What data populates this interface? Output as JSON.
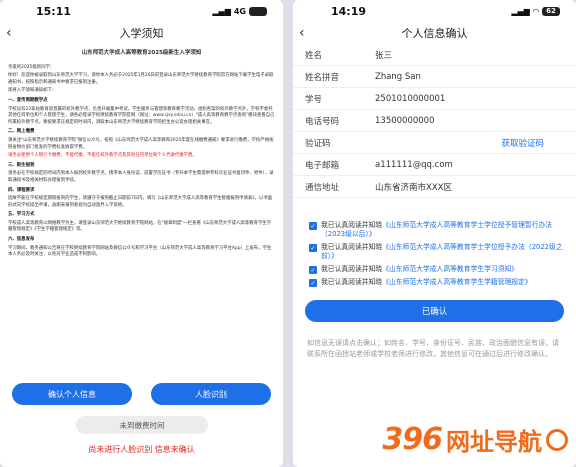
{
  "left": {
    "time": "15:11",
    "net": "4G",
    "title": "入学须知",
    "doc_title": "山东师范大学成人高等教育2025级新生入学须知",
    "paras": [
      {
        "t": "亲爱的2025级新同学：",
        "cls": ""
      },
      {
        "t": "你好！欢迎你被录取到山东师范大学学习，请你本人务必于2025年1月26日前登录山东师范大学继续教育学院官方网站下载学生电子录取通知书，按照指示和通知书中要求已报到注册。",
        "cls": ""
      },
      {
        "t": "现将入学须知通知如下：",
        "cls": ""
      },
      {
        "t": "一、宣传周期教学点",
        "cls": "h"
      },
      {
        "t": "学校设有22家站教育部直属的校外教学点，负责开展集中考试，学生服务与管理等教育教学活动，组织各案的校外教学点外，学校不委托其他任何单位和个人管理学生，请各必登录学校继续教育学院官网（网址：www.sjxy.sdnu.cn）\"成人高等教育教学点查询\"模块查看自己所属校外教学点，要按要求在规定的时间内，调取本山东师范大学继续教育学院招生办公室办理相关事宜。",
        "cls": ""
      },
      {
        "t": "二、网上缴费",
        "cls": "h"
      },
      {
        "t": "请关注\"山东师范大学继续教育学院\"微信公众号，按照《山东师范大学成人高等教育2025年度在线缴费通知》要求进行缴费，学校严格按照省物价部门批准的学费标准收取学费。",
        "cls": ""
      },
      {
        "t": "请务必使用个人银行卡缴费，不能代缴，不能任校外教学点及其他任何单位和个人代收代缴学费。",
        "cls": "red"
      },
      {
        "t": "三、新生报到",
        "cls": "h"
      },
      {
        "t": "请务必在学校规定的时间内到本人报到校外教学点，携带本人身份证、前置学历证书（专升本学生需提供专科毕业证书复印件、原件）、录取通知书及相关材料办理报到手续。",
        "cls": ""
      },
      {
        "t": "四、课程要求",
        "cls": "h"
      },
      {
        "t": "因故不能在学校规定期限报到的学生，请遵守于报到截止日期前7日内，填写《山东师范大学成人高等教育学生暂缓报到申请表》，以书面形式向学校提出申请，逾期未报到者视为自动放弃入学资格。",
        "cls": ""
      },
      {
        "t": "五、学习方式",
        "cls": "h"
      },
      {
        "t": "学校成人高等教育以网络教学为主，请登录山东师范大学继续教育学院网站，在\"规章制度\"一栏查看《山东师范大学成人高等教育学生学籍管理规定》《学生学籍管理规定》等。",
        "cls": ""
      },
      {
        "t": "六、信息发布",
        "cls": "h"
      },
      {
        "t": "学习期间，教务通知公告将在学校继续教育学院网站及微信公众号和学习平台（山东师范大学成人高等教育学习平台App）上发布，学生本人务必及时关注，以免对学业造成不利影响。",
        "cls": ""
      }
    ],
    "btn_confirm": "确认个人信息",
    "btn_face": "人脸识别",
    "btn_unpaid": "未到缴费时间",
    "warning": "尚未进行人脸识别 信息未确认"
  },
  "right": {
    "time": "14:19",
    "battery": "62",
    "title": "个人信息确认",
    "fields": [
      {
        "label": "姓名",
        "value": "张三"
      },
      {
        "label": "姓名拼音",
        "value": "Zhang San"
      },
      {
        "label": "学号",
        "value": "2501010000001"
      },
      {
        "label": "电话号码",
        "value": "13500000000"
      },
      {
        "label": "验证码",
        "value": "",
        "link": "获取验证码"
      },
      {
        "label": "电子邮箱",
        "value": "a111111@qq.com"
      },
      {
        "label": "通信地址",
        "value": "山东省济南市XXX区"
      }
    ],
    "agreements": [
      {
        "pre": "我已认真阅读并知晓",
        "doc": "《山东师范大学成人高等教育学士学位授予管理暂行办法（2023级以后）》"
      },
      {
        "pre": "我已认真阅读并知晓",
        "doc": "《山东师范大学成人高等教育学士学位授予办法（2022级之前）》"
      },
      {
        "pre": "我已认真阅读并知晓",
        "doc": "《山东师范大学成人高等教育学生学习须知》"
      },
      {
        "pre": "我已认真阅读并知晓",
        "doc": "《山东师范大学成人高等教育学生学籍管理规定》"
      }
    ],
    "confirm": "已确认",
    "note": "如信息无误请点击确认；如姓名、学号、身份证号、民族、政治面貌信息有误，请联系所在函授站老师或学校老师进行修改，其他信息可在通过后进行修改确认。"
  },
  "watermark": {
    "num": "396",
    "text": "网址导航"
  }
}
